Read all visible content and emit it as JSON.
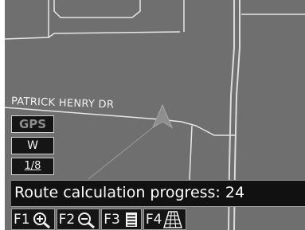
{
  "map": {
    "street_name": "PATRICK HENRY DR",
    "colors": {
      "background": "#6f6f6f",
      "road": "#e6e6e6",
      "highway": "#dcdcdc",
      "vehicle": "#8e8e8e"
    }
  },
  "side_panel": {
    "gps_label": "GPS",
    "heading": "W",
    "scale": "1/8"
  },
  "status": {
    "text": "Route calculation progress: 24"
  },
  "function_keys": [
    {
      "label": "F1",
      "icon": "zoom-in-icon"
    },
    {
      "label": "F2",
      "icon": "zoom-out-icon"
    },
    {
      "label": "F3",
      "icon": "list-icon"
    },
    {
      "label": "F4",
      "icon": "perspective-view-icon"
    }
  ]
}
